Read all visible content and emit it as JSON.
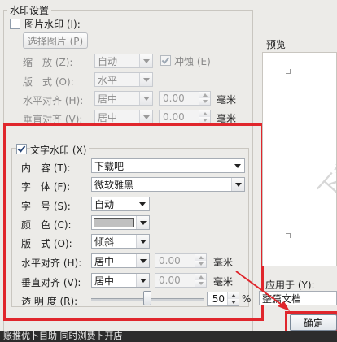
{
  "watermark_group": {
    "title": "水印设置"
  },
  "picture_watermark": {
    "checkbox_label": "图片水印 (I):",
    "checked": false,
    "select_picture_label": "选择图片 (P)",
    "scale_label": "缩　放 (Z):",
    "scale_value": "自动",
    "washout_label": "冲蚀 (E)",
    "washout_checked": true,
    "layout_label": "版　式 (O):",
    "layout_value": "水平",
    "h_align_label": "水平对齐 (H):",
    "h_align_value": "居中",
    "h_offset": "0.00",
    "v_align_label": "垂直对齐 (V):",
    "v_align_value": "居中",
    "v_offset": "0.00",
    "unit": "毫米"
  },
  "text_watermark": {
    "checkbox_label": "文字水印 (X)",
    "checked": true,
    "content_label": "内　容 (T):",
    "content_value": "下载吧",
    "font_label": "字　体 (F):",
    "font_value": "微软雅黑",
    "size_label": "字　号 (S):",
    "size_value": "自动",
    "color_label": "颜　色 (C):",
    "color_value": "#c0c0c0",
    "layout_label": "版　式 (O):",
    "layout_value": "倾斜",
    "h_align_label": "水平对齐 (H):",
    "h_align_value": "居中",
    "h_offset": "0.00",
    "v_align_label": "垂直对齐 (V):",
    "v_align_value": "居中",
    "v_offset": "0.00",
    "unit": "毫米",
    "transparency_label": "透 明 度 (R):",
    "transparency_value": "50",
    "transparency_fraction": 0.5,
    "percent": "%"
  },
  "preview": {
    "label": "预览",
    "watermark_text": "下载"
  },
  "apply_to": {
    "label": "应用于 (Y):",
    "value": "整篇文档"
  },
  "ok_button": {
    "label": "确定"
  },
  "status_bar": {
    "text": "账推优卜目助 同时浏费卜开店"
  },
  "colors": {
    "highlight": "#e0262c"
  }
}
